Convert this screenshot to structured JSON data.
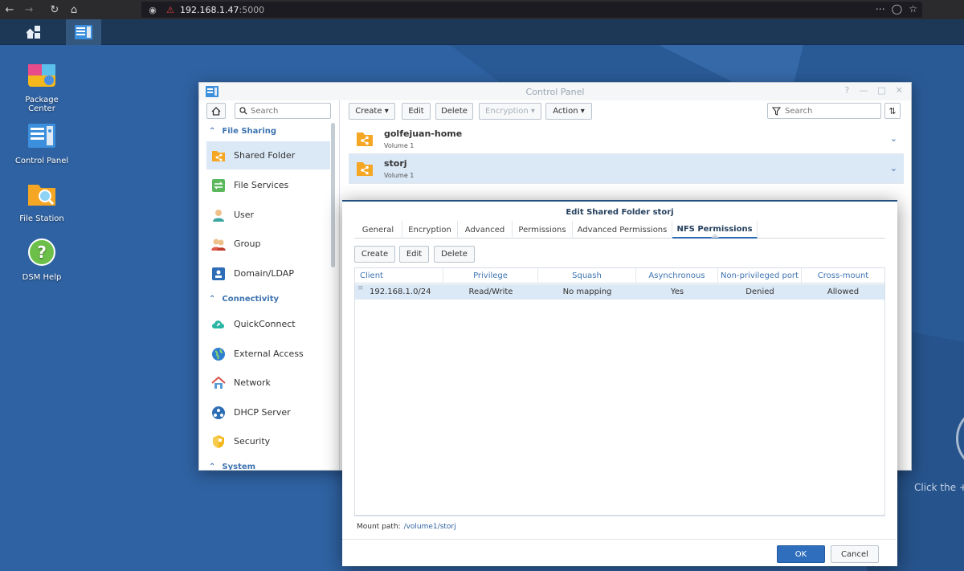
{
  "browser": {
    "url_host": "192.168.1.47",
    "url_port": ":5000",
    "nav_icons": [
      "back-icon",
      "forward-icon",
      "reload-icon",
      "home-icon"
    ]
  },
  "desktop": {
    "icons": [
      {
        "label_1": "Package",
        "label_2": "Center",
        "icon": "package-center-icon"
      },
      {
        "label_1": "Control Panel",
        "label_2": "",
        "icon": "control-panel-icon"
      },
      {
        "label_1": "File Station",
        "label_2": "",
        "icon": "file-station-icon"
      },
      {
        "label_1": "DSM Help",
        "label_2": "",
        "icon": "dsm-help-icon"
      }
    ],
    "hint": "Click the +"
  },
  "control_panel": {
    "title": "Control Panel",
    "search_placeholder": "Search",
    "sections": {
      "file_sharing": "File Sharing",
      "connectivity": "Connectivity",
      "system": "System"
    },
    "items": {
      "shared_folder": "Shared Folder",
      "file_services": "File Services",
      "user": "User",
      "group": "Group",
      "domain_ldap": "Domain/LDAP",
      "quickconnect": "QuickConnect",
      "external_access": "External Access",
      "network": "Network",
      "dhcp_server": "DHCP Server",
      "security": "Security"
    },
    "toolbar": {
      "create": "Create",
      "edit": "Edit",
      "delete": "Delete",
      "encryption": "Encryption",
      "action": "Action",
      "search_placeholder": "Search"
    },
    "folders": [
      {
        "name": "golfejuan-home",
        "volume": "Volume 1"
      },
      {
        "name": "storj",
        "volume": "Volume 1"
      }
    ]
  },
  "dialog": {
    "title": "Edit Shared Folder storj",
    "tabs": [
      "General",
      "Encryption",
      "Advanced",
      "Permissions",
      "Advanced Permissions",
      "NFS Permissions"
    ],
    "active_tab": "NFS Permissions",
    "buttons": {
      "create": "Create",
      "edit": "Edit",
      "delete": "Delete"
    },
    "columns": [
      "Client",
      "Privilege",
      "Squash",
      "Asynchronous",
      "Non-privileged port",
      "Cross-mount"
    ],
    "rows": [
      {
        "client": "192.168.1.0/24",
        "privilege": "Read/Write",
        "squash": "No mapping",
        "asynchronous": "Yes",
        "non_privileged_port": "Denied",
        "cross_mount": "Allowed"
      }
    ],
    "mount_label": "Mount path:",
    "mount_path": "/volume1/storj",
    "ok": "OK",
    "cancel": "Cancel"
  },
  "colors": {
    "accent": "#2f6dbd",
    "section_label": "#3d73b0",
    "selected_row": "#dbe8f6",
    "desktop": "#2f62a2"
  }
}
